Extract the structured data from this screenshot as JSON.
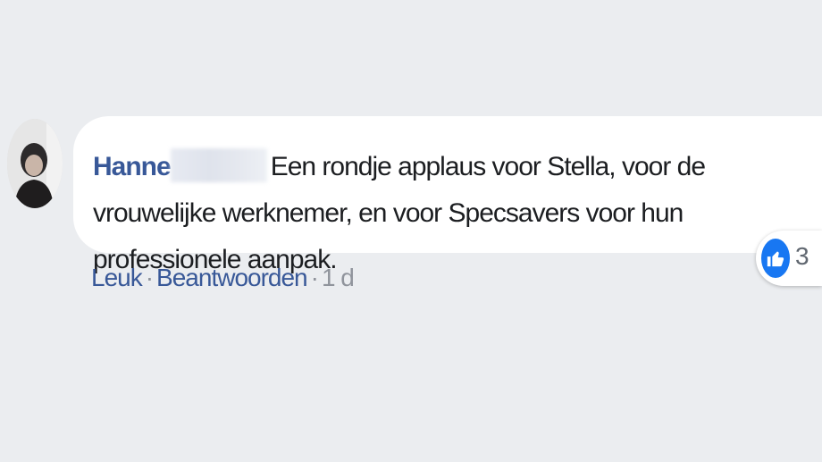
{
  "comment": {
    "author": "Hanne",
    "text": "Een rondje applaus voor Stella, voor de vrouwelijke werknemer, en voor Specsavers voor hun professionele aanpak.",
    "reactions": {
      "icon": "like-icon",
      "count": "3",
      "color": "#1877f2"
    },
    "actions": {
      "like_label": "Leuk",
      "separator": "·",
      "reply_label": "Beantwoorden",
      "timestamp": "1 d"
    }
  },
  "colors": {
    "background": "#ebedf0",
    "bubble": "#ffffff",
    "author_link": "#385898",
    "text": "#1c1e21",
    "meta": "#90949c"
  }
}
